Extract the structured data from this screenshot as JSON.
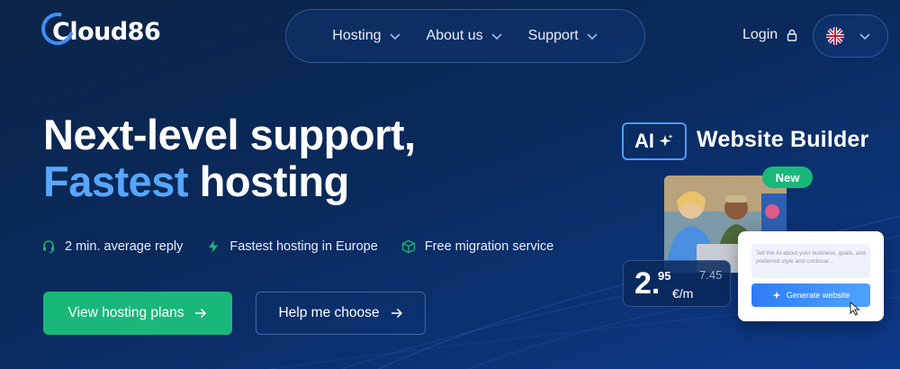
{
  "header": {
    "logo_text": "Cloud86",
    "nav": [
      {
        "label": "Hosting"
      },
      {
        "label": "About us"
      },
      {
        "label": "Support"
      }
    ],
    "login_label": "Login",
    "language": "en-GB"
  },
  "hero": {
    "title_line1": "Next-level support,",
    "title_accent": "Fastest",
    "title_rest": "hosting",
    "features": [
      {
        "icon": "headset-icon",
        "label": "2 min. average reply"
      },
      {
        "icon": "lightning-icon",
        "label": "Fastest hosting in Europe"
      },
      {
        "icon": "box-icon",
        "label": "Free migration service"
      }
    ],
    "primary_button": "View hosting plans",
    "secondary_button": "Help me choose"
  },
  "promo": {
    "ai_badge": "AI",
    "title": "Website Builder",
    "new_badge": "New",
    "price_int": "2.",
    "price_dec": "95",
    "price_old": "7.45",
    "price_unit": "€/m",
    "prompt_text": "Tell the AI about your business, goals, and preferred style and continue...",
    "generate_label": "Generate website"
  },
  "colors": {
    "accent": "#58a6ff",
    "primary_button": "#19b87a",
    "background": "#0b2447"
  }
}
